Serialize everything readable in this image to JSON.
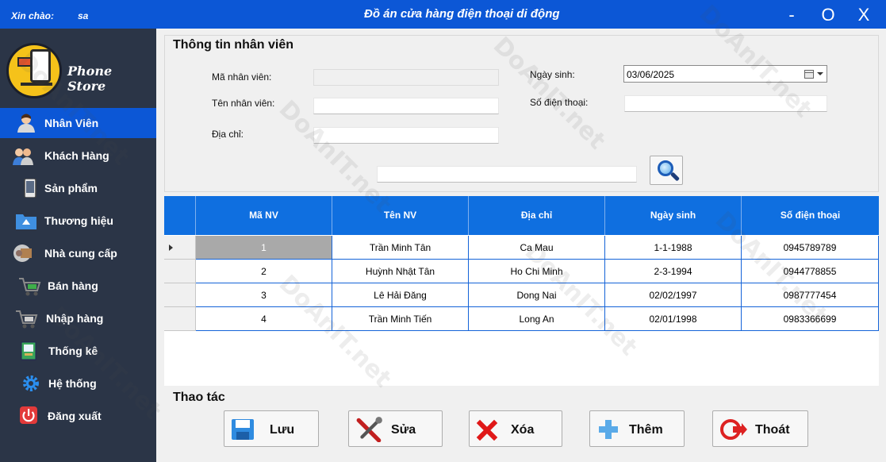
{
  "window": {
    "greeting": "Xin chào:",
    "user": "sa",
    "title": "Đồ án cửa hàng điện thoại di động",
    "minimize": "-",
    "maximize": "O",
    "close": "X"
  },
  "sidebar": {
    "logo_text": "Phone Store",
    "items": [
      {
        "label": "Nhân Viên",
        "icon": "person-icon"
      },
      {
        "label": "Khách Hàng",
        "icon": "customers-icon"
      },
      {
        "label": "Sản phẩm",
        "icon": "phone-icon"
      },
      {
        "label": "Thương hiệu",
        "icon": "folder-icon"
      },
      {
        "label": "Nhà cung cấp",
        "icon": "supplier-icon"
      },
      {
        "label": "Bán hàng",
        "icon": "cart-icon"
      },
      {
        "label": "Nhập hàng",
        "icon": "import-cart-icon"
      },
      {
        "label": "Thống kê",
        "icon": "book-icon"
      },
      {
        "label": "Hệ thống",
        "icon": "gear-icon"
      },
      {
        "label": "Đăng xuất",
        "icon": "power-icon"
      }
    ],
    "active_index": 0
  },
  "form": {
    "title": "Thông tin nhân viên",
    "ma_label": "Mã nhân viên:",
    "ma_value": "",
    "ten_label": "Tên nhân viên:",
    "ten_value": "",
    "diachi_label": "Địa chỉ:",
    "diachi_value": "",
    "ngaysinh_label": "Ngày sinh:",
    "ngaysinh_value": "03/06/2025",
    "sdt_label": "Số điện thoại:",
    "sdt_value": "",
    "search_value": ""
  },
  "table": {
    "columns": [
      "Mã NV",
      "Tên NV",
      "Địa chỉ",
      "Ngày sinh",
      "Số điện thoại"
    ],
    "rows": [
      [
        "1",
        "Trần Minh Tân",
        "Ca Mau",
        "1-1-1988",
        "0945789789"
      ],
      [
        "2",
        "Huỳnh Nhật Tân",
        "Ho Chi Minh",
        "2-3-1994",
        "0944778855"
      ],
      [
        "3",
        "Lê Hải Đăng",
        "Dong Nai",
        "02/02/1997",
        "0987777454"
      ],
      [
        "4",
        "Trần Minh Tiến",
        "Long An",
        "02/01/1998",
        "0983366699"
      ]
    ],
    "selected_row": 0
  },
  "actions": {
    "title": "Thao tác",
    "save": "Lưu",
    "edit": "Sửa",
    "delete": "Xóa",
    "add": "Thêm",
    "exit": "Thoát"
  },
  "colors": {
    "accent": "#0c57d6",
    "sidebar_bg": "#2b3547",
    "grid_header": "#0f6fe0"
  },
  "watermark": "DoAnIT.net"
}
